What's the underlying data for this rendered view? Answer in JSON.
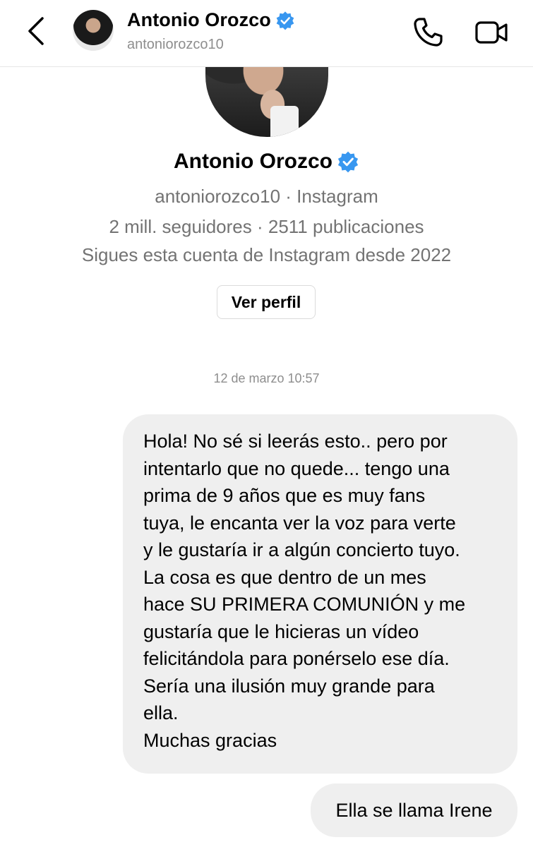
{
  "header": {
    "back_icon": "chevron-left-icon",
    "name": "Antonio Orozco",
    "handle": "antoniorozco10",
    "verified_icon": "verified-badge-icon",
    "call_icon": "phone-icon",
    "video_icon": "video-camera-icon"
  },
  "profile": {
    "name": "Antonio Orozco",
    "platform_line": "antoniorozco10 · Instagram",
    "stats_line": "2 mill. seguidores · 2511 publicaciones",
    "follow_line": "Sigues esta cuenta de Instagram desde 2022",
    "view_profile_label": "Ver perfil"
  },
  "conversation": {
    "timestamp": "12 de marzo 10:57",
    "messages": [
      {
        "lines": [
          "Hola! No sé si leerás esto.. pero por",
          "intentarlo que no quede... tengo una",
          "prima de 9 años que es muy fans",
          "tuya, le encanta ver la voz para verte",
          "y le gustaría ir a algún concierto tuyo.",
          "La cosa es que dentro de un mes",
          "hace SU PRIMERA COMUNIÓN y me",
          "gustaría que le hicieras un vídeo",
          "felicitándola para ponérselo ese día.",
          "Sería una ilusión muy grande para",
          "ella.",
          "Muchas gracias"
        ]
      },
      {
        "text": "Ella se llama Irene"
      }
    ]
  },
  "colors": {
    "verified_blue": "#3897f0",
    "bubble_gray": "#efefef",
    "secondary_text": "#737373"
  }
}
